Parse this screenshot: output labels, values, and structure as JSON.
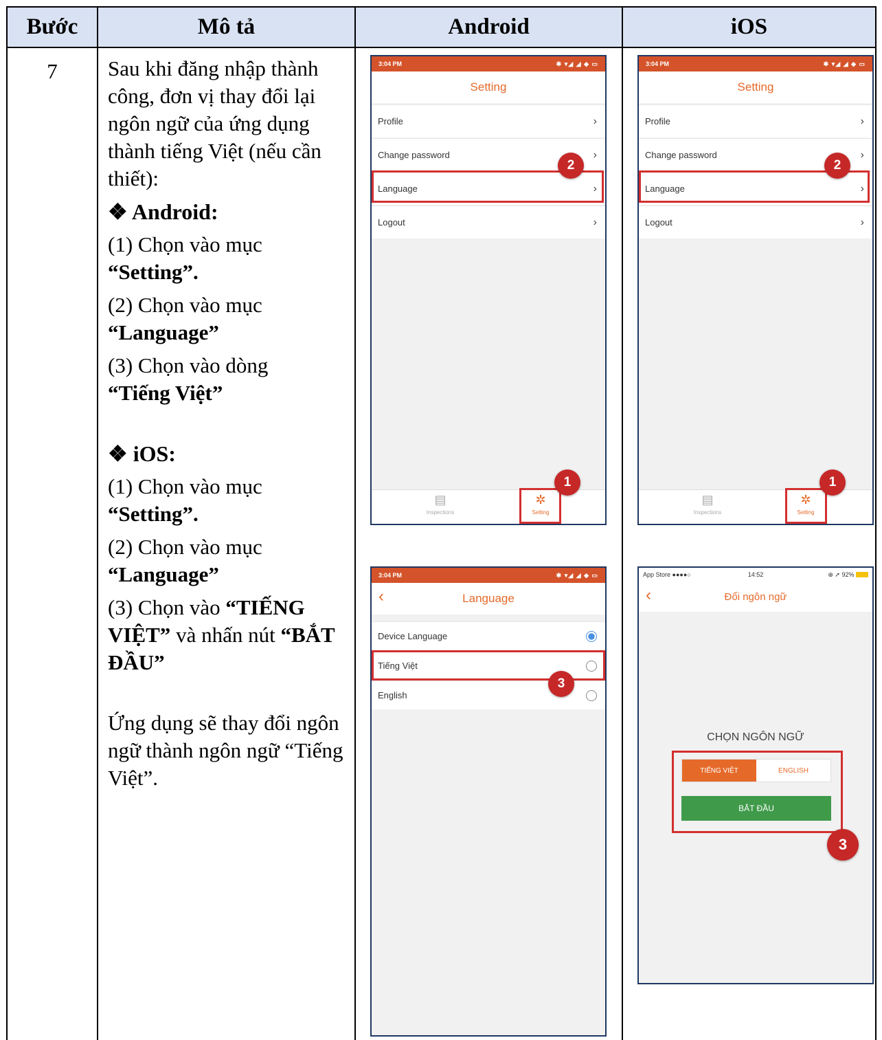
{
  "table": {
    "headers": {
      "step": "Bước",
      "description": "Mô tả",
      "android": "Android",
      "ios": "iOS"
    },
    "step_number": "7",
    "description": {
      "intro": "Sau khi đăng nhập thành công, đơn vị thay đổi lại ngôn ngữ của ứng dụng thành tiếng Việt (nếu cần thiết):",
      "android_heading": "❖ Android:",
      "android_step1_text": "(1) Chọn vào mục",
      "android_step1_bold": "“Setting”.",
      "android_step2_text": "(2) Chọn vào mục",
      "android_step2_bold": "“Language”",
      "android_step3_text": "(3) Chọn vào dòng",
      "android_step3_bold": "“Tiếng Việt”",
      "ios_heading": "❖ iOS:",
      "ios_step1_text": "(1) Chọn vào mục",
      "ios_step1_bold": "“Setting”.",
      "ios_step2_text": "(2) Chọn vào mục",
      "ios_step2_bold": "“Language”",
      "ios_step3_pre": "(3) Chọn vào ",
      "ios_step3_bold1": "“TIẾNG VIỆT”",
      "ios_step3_mid": " và nhấn nút ",
      "ios_step3_bold2": "“BẮT ĐẦU”",
      "result": "Ứng dụng sẽ thay đổi ngôn ngữ thành ngôn ngữ “Tiếng Việt”."
    }
  },
  "settings_screen": {
    "status_time": "3:04 PM",
    "status_icons": "✱ ▾◢ ◢ ◆ ▭",
    "title": "Setting",
    "items": [
      "Profile",
      "Change password",
      "Language",
      "Logout"
    ],
    "chevron": "›",
    "tabs": [
      "Inspections",
      "Setting"
    ],
    "badge_1": "1",
    "badge_2": "2"
  },
  "android_language_screen": {
    "status_time": "3:04 PM",
    "status_icons": "✱ ▾◢ ◢ ◆ ▭",
    "back": "‹",
    "title": "Language",
    "options": [
      "Device Language",
      "Tiếng Việt",
      "English"
    ],
    "badge_3": "3"
  },
  "ios_language_screen": {
    "status_left": "App Store ●●●●○",
    "status_time": "14:52",
    "status_right": "⊕ ➚ 92%",
    "back": "‹",
    "title": "Đổi ngôn ngữ",
    "choose_label": "CHỌN NGÔN NGỮ",
    "segment_vi": "TIẾNG VIỆT",
    "segment_en": "ENGLISH",
    "start_button": "BẮT ĐẦU",
    "badge_3": "3"
  },
  "colors": {
    "accent": "#e56a2a",
    "status_bar": "#d4532a",
    "highlight": "#d32f2f",
    "badge": "#c62828",
    "start_green": "#3f9a4a",
    "header_bg": "#d9e2f3",
    "frame_border": "#1f3864"
  },
  "icons": {
    "inspections_tab": "clipboard-icon",
    "setting_tab": "gear-icon",
    "list_chevron": "chevron-right-icon",
    "back": "chevron-left-icon",
    "bullet": "diamond-bullet-icon"
  }
}
